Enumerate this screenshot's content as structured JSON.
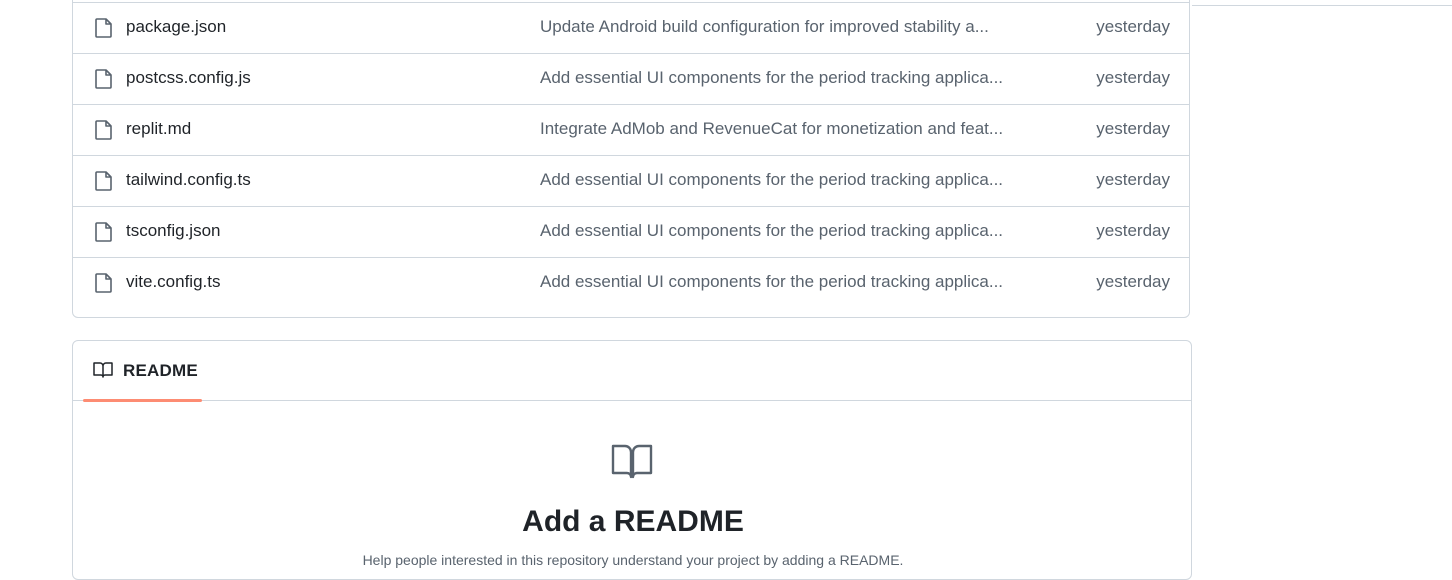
{
  "files": [
    {
      "name": "package.json",
      "message": "Update Android build configuration for improved stability a...",
      "date": "yesterday"
    },
    {
      "name": "postcss.config.js",
      "message": "Add essential UI components for the period tracking applica...",
      "date": "yesterday"
    },
    {
      "name": "replit.md",
      "message": "Integrate AdMob and RevenueCat for monetization and feat...",
      "date": "yesterday"
    },
    {
      "name": "tailwind.config.ts",
      "message": "Add essential UI components for the period tracking applica...",
      "date": "yesterday"
    },
    {
      "name": "tsconfig.json",
      "message": "Add essential UI components for the period tracking applica...",
      "date": "yesterday"
    },
    {
      "name": "vite.config.ts",
      "message": "Add essential UI components for the period tracking applica...",
      "date": "yesterday"
    }
  ],
  "readme": {
    "tab_label": "README",
    "title": "Add a README",
    "description": "Help people interested in this repository understand your project by adding a README.",
    "tab_icon": "book-icon",
    "body_icon": "book-icon"
  },
  "colors": {
    "accent_underline": "#fd8c73",
    "border": "#d0d7de",
    "muted_text": "#59636e",
    "text": "#1f2328"
  }
}
